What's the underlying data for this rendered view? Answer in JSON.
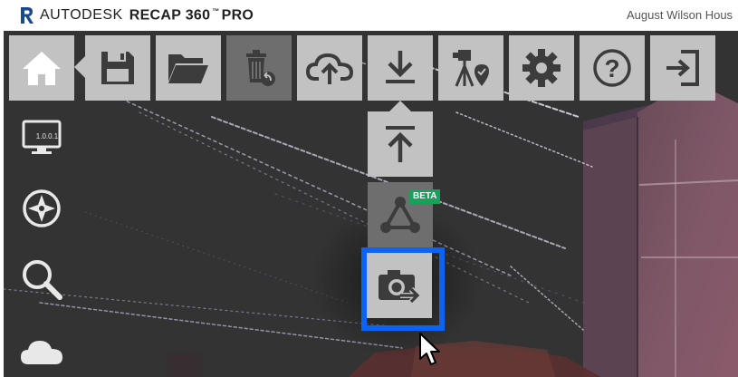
{
  "header": {
    "brand": "AUTODESK",
    "product": "RECAP 360",
    "trademark": "™",
    "edition": "PRO",
    "project_title": "August Wilson Hous"
  },
  "toolbar": {
    "items": [
      {
        "name": "home",
        "icon": "home-icon"
      },
      {
        "name": "save",
        "icon": "floppy-disk-icon"
      },
      {
        "name": "open",
        "icon": "folder-open-icon"
      },
      {
        "name": "recycle-bin",
        "icon": "trash-restore-icon"
      },
      {
        "name": "upload",
        "icon": "cloud-upload-icon"
      },
      {
        "name": "export",
        "icon": "download-icon"
      },
      {
        "name": "scan-location",
        "icon": "scanner-location-icon"
      },
      {
        "name": "settings",
        "icon": "gear-icon"
      },
      {
        "name": "help",
        "icon": "help-icon",
        "label": "?"
      },
      {
        "name": "exit",
        "icon": "exit-icon"
      }
    ]
  },
  "export_menu": {
    "items": [
      {
        "name": "export-pointcloud",
        "icon": "upload-arrow-icon"
      },
      {
        "name": "export-mesh",
        "icon": "mesh-triangle-icon",
        "badge": "BETA"
      },
      {
        "name": "export-snapshot",
        "icon": "camera-export-icon"
      }
    ]
  },
  "side_tools": {
    "items": [
      {
        "name": "display-settings",
        "icon": "monitor-icon",
        "label": "1.0.0.1"
      },
      {
        "name": "navigation",
        "icon": "compass-icon"
      },
      {
        "name": "search",
        "icon": "magnifier-icon"
      },
      {
        "name": "cloud",
        "icon": "cloud-icon"
      }
    ]
  },
  "colors": {
    "viewport": "#333333",
    "button": "#c2c2c2",
    "button_disabled": "#6e6e6e",
    "icon": "#3c3c3c",
    "highlight": "#0a63f5",
    "beta_badge": "#1aa05a"
  }
}
